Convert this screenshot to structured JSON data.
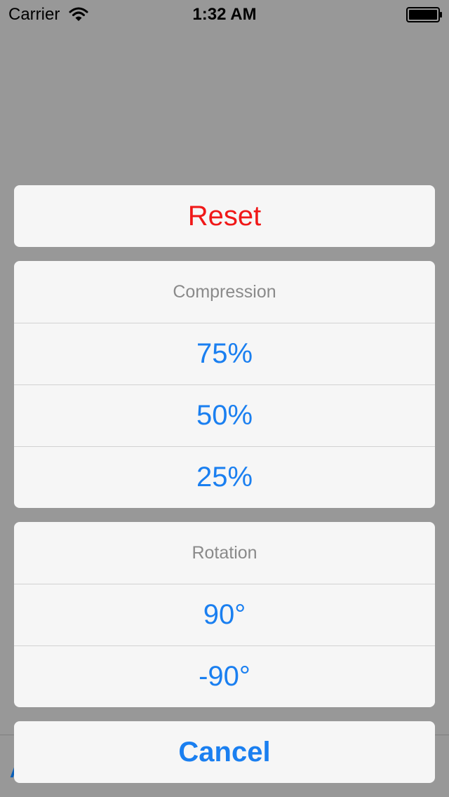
{
  "status_bar": {
    "carrier": "Carrier",
    "time": "1:32 AM",
    "wifi_icon": "wifi-icon",
    "battery_icon": "battery-full-icon"
  },
  "background": {
    "toolbar_item_partial": "A"
  },
  "action_sheet": {
    "reset_label": "Reset",
    "compression": {
      "title": "Compression",
      "options": [
        "75%",
        "50%",
        "25%"
      ]
    },
    "rotation": {
      "title": "Rotation",
      "options": [
        "90°",
        "-90°"
      ]
    },
    "cancel_label": "Cancel"
  },
  "colors": {
    "overlay": "#989898",
    "sheet_background": "#f6f6f6",
    "action_blue": "#1a7ff0",
    "destructive_red": "#f01818",
    "title_gray": "#8a8a8a"
  }
}
